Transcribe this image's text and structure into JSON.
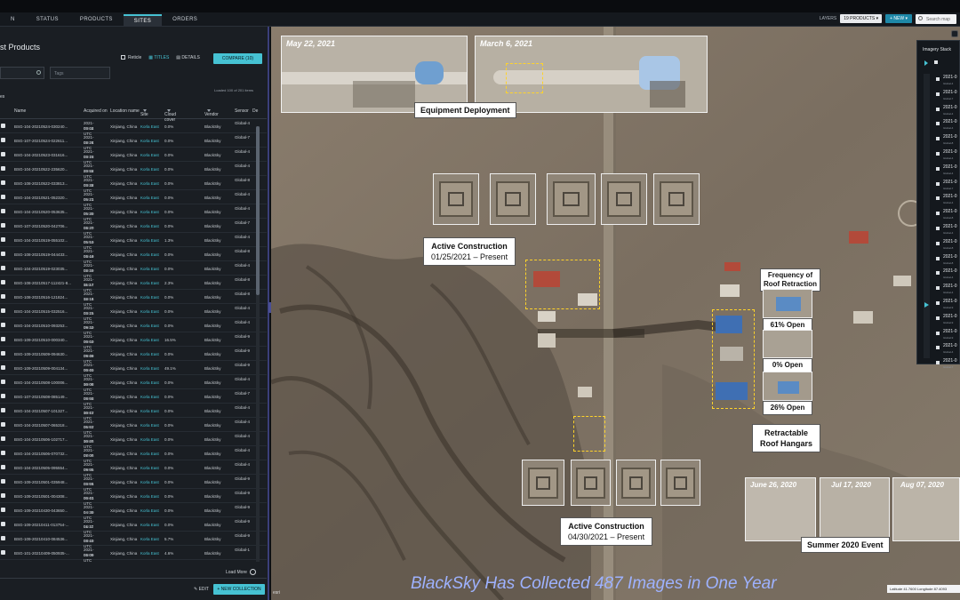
{
  "nav": {
    "tabs": [
      "N",
      "STATUS",
      "PRODUCTS",
      "SITES",
      "ORDERS"
    ],
    "active": "SITES"
  },
  "topbar": {
    "layers_label": "LAYERS",
    "layers_button": "19 PRODUCTS ▾",
    "new_button": "+ NEW ▾",
    "search_placeholder": "Search map"
  },
  "panel": {
    "title": "st Products",
    "reticle_label": "Reticle",
    "titles_label": "TITLES",
    "details_label": "DETAILS",
    "compare_button": "COMPARE (10)",
    "tags_placeholder": "Tags",
    "loaded_text": "Loaded 100 of 201 items",
    "header_left": "es",
    "columns": [
      "Name",
      "Acquired on",
      "Location name",
      "Site",
      "Cloud cover",
      "Vendor",
      "Sensor",
      "De"
    ],
    "rows": [
      {
        "name": "BSG-104-20210524-030240...",
        "date": "2021-05-24",
        "time": "03:02 UTC",
        "loc": "Xinjiang, China",
        "site": "Korla East",
        "cloud": "0.0%",
        "vendor": "BlackSky",
        "sensor": "Global-4"
      },
      {
        "name": "BSG-107-20210524-022611...",
        "date": "2021-05-24",
        "time": "02:26 UTC",
        "loc": "Xinjiang, China",
        "site": "Korla East",
        "cloud": "0.0%",
        "vendor": "BlackSky",
        "sensor": "Global-7"
      },
      {
        "name": "BSG-104-20210523-031616...",
        "date": "2021-05-23",
        "time": "03:16 UTC",
        "loc": "Xinjiang, China",
        "site": "Korla East",
        "cloud": "0.0%",
        "vendor": "BlackSky",
        "sensor": "Global-4"
      },
      {
        "name": "BSG-104-20210522-235620...",
        "date": "2021-05-22",
        "time": "23:56 UTC",
        "loc": "Xinjiang, China",
        "site": "Korla East",
        "cloud": "0.0%",
        "vendor": "BlackSky",
        "sensor": "Global-4"
      },
      {
        "name": "BSG-108-20210522-033813...",
        "date": "2021-05-22",
        "time": "03:38 UTC",
        "loc": "Xinjiang, China",
        "site": "Korla East",
        "cloud": "0.0%",
        "vendor": "BlackSky",
        "sensor": "Global-8"
      },
      {
        "name": "BSG-104-20210521-052320...",
        "date": "2021-05-21",
        "time": "05:23 UTC",
        "loc": "Xinjiang, China",
        "site": "Korla East",
        "cloud": "0.0%",
        "vendor": "BlackSky",
        "sensor": "Global-4"
      },
      {
        "name": "BSG-104-20210520-053635...",
        "date": "2021-05-20",
        "time": "05:36 UTC",
        "loc": "Xinjiang, China",
        "site": "Korla East",
        "cloud": "0.0%",
        "vendor": "BlackSky",
        "sensor": "Global-4"
      },
      {
        "name": "BSG-107-20210520-042706...",
        "date": "2021-05-20",
        "time": "04:27 UTC",
        "loc": "Xinjiang, China",
        "site": "Korla East",
        "cloud": "0.0%",
        "vendor": "BlackSky",
        "sensor": "Global-7"
      },
      {
        "name": "BSG-104-20210519-055102...",
        "date": "2021-05-19",
        "time": "05:51 UTC",
        "loc": "Xinjiang, China",
        "site": "Korla East",
        "cloud": "1.3%",
        "vendor": "BlackSky",
        "sensor": "Global-4"
      },
      {
        "name": "BSG-108-20210519-044433...",
        "date": "2021-05-19",
        "time": "04:44 UTC",
        "loc": "Xinjiang, China",
        "site": "Korla East",
        "cloud": "0.0%",
        "vendor": "BlackSky",
        "sensor": "Global-8"
      },
      {
        "name": "BSG-104-20210519-023035...",
        "date": "2021-05-19",
        "time": "02:30 UTC",
        "loc": "Xinjiang, China",
        "site": "Korla East",
        "cloud": "0.0%",
        "vendor": "BlackSky",
        "sensor": "Global-4"
      },
      {
        "name": "BSG-108-20210517-112421-8...",
        "date": "2021-05-17",
        "time": "11:24 UTC",
        "loc": "Xinjiang, China",
        "site": "Korla East",
        "cloud": "2.3%",
        "vendor": "BlackSky",
        "sensor": "Global-8"
      },
      {
        "name": "BSG-108-20210516-121824...",
        "date": "2021-05-16",
        "time": "12:18 UTC",
        "loc": "Xinjiang, China",
        "site": "Korla East",
        "cloud": "0.0%",
        "vendor": "BlackSky",
        "sensor": "Global-8"
      },
      {
        "name": "BSG-104-20210515-032516...",
        "date": "2021-05-15",
        "time": "03:25 UTC",
        "loc": "Xinjiang, China",
        "site": "Korla East",
        "cloud": "0.0%",
        "vendor": "BlackSky",
        "sensor": "Global-4"
      },
      {
        "name": "BSG-104-20210510-093253...",
        "date": "2021-05-10",
        "time": "09:32 UTC",
        "loc": "Xinjiang, China",
        "site": "Korla East",
        "cloud": "0.0%",
        "vendor": "BlackSky",
        "sensor": "Global-4"
      },
      {
        "name": "BSG-109-20210510-000340...",
        "date": "2021-05-10",
        "time": "00:03 UTC",
        "loc": "Xinjiang, China",
        "site": "Korla East",
        "cloud": "16.5%",
        "vendor": "BlackSky",
        "sensor": "Global-9"
      },
      {
        "name": "BSG-109-20210509-094630...",
        "date": "2021-05-09",
        "time": "09:46 UTC",
        "loc": "Xinjiang, China",
        "site": "Korla East",
        "cloud": "0.0%",
        "vendor": "BlackSky",
        "sensor": "Global-9"
      },
      {
        "name": "BSG-109-20210509-004134...",
        "date": "2021-05-09",
        "time": "00:41 UTC",
        "loc": "Xinjiang, China",
        "site": "Korla East",
        "cloud": "49.1%",
        "vendor": "BlackSky",
        "sensor": "Global-9"
      },
      {
        "name": "BSG-104-20210508-100006...",
        "date": "2021-05-08",
        "time": "10:00 UTC",
        "loc": "Xinjiang, China",
        "site": "Korla East",
        "cloud": "0.0%",
        "vendor": "BlackSky",
        "sensor": "Global-4"
      },
      {
        "name": "BSG-107-20210508-085149...",
        "date": "2021-05-08",
        "time": "08:51 UTC",
        "loc": "Xinjiang, China",
        "site": "Korla East",
        "cloud": "0.0%",
        "vendor": "BlackSky",
        "sensor": "Global-7"
      },
      {
        "name": "BSG-104-20210507-101327...",
        "date": "2021-05-07",
        "time": "10:13 UTC",
        "loc": "Xinjiang, China",
        "site": "Korla East",
        "cloud": "0.0%",
        "vendor": "BlackSky",
        "sensor": "Global-4"
      },
      {
        "name": "BSG-104-20210507-065318...",
        "date": "2021-05-07",
        "time": "06:53 UTC",
        "loc": "Xinjiang, China",
        "site": "Korla East",
        "cloud": "0.0%",
        "vendor": "BlackSky",
        "sensor": "Global-4"
      },
      {
        "name": "BSG-104-20210506-102717...",
        "date": "2021-05-06",
        "time": "10:27 UTC",
        "loc": "Xinjiang, China",
        "site": "Korla East",
        "cloud": "0.0%",
        "vendor": "BlackSky",
        "sensor": "Global-4"
      },
      {
        "name": "BSG-104-20210506-070732...",
        "date": "2021-05-06",
        "time": "07:07 UTC",
        "loc": "Xinjiang, China",
        "site": "Korla East",
        "cloud": "0.0%",
        "vendor": "BlackSky",
        "sensor": "Global-4"
      },
      {
        "name": "BSG-104-20210505-095554...",
        "date": "2021-05-05",
        "time": "09:55 UTC",
        "loc": "Xinjiang, China",
        "site": "Korla East",
        "cloud": "0.0%",
        "vendor": "BlackSky",
        "sensor": "Global-4"
      },
      {
        "name": "BSG-109-20210501-035948...",
        "date": "2021-05-01",
        "time": "03:59 UTC",
        "loc": "Xinjiang, China",
        "site": "Korla East",
        "cloud": "0.0%",
        "vendor": "BlackSky",
        "sensor": "Global-9"
      },
      {
        "name": "BSG-109-20210501-004308...",
        "date": "2021-05-01",
        "time": "00:43 UTC",
        "loc": "Xinjiang, China",
        "site": "Korla East",
        "cloud": "0.0%",
        "vendor": "BlackSky",
        "sensor": "Global-9"
      },
      {
        "name": "BSG-109-20210430-043650...",
        "date": "2021-04-30",
        "time": "04:36 UTC",
        "loc": "Xinjiang, China",
        "site": "Korla East",
        "cloud": "0.0%",
        "vendor": "BlackSky",
        "sensor": "Global-9"
      },
      {
        "name": "BSG-109-20210411-013754-...",
        "date": "2021-04-11",
        "time": "01:37 UTC",
        "loc": "Xinjiang, China",
        "site": "Korla East",
        "cloud": "0.0%",
        "vendor": "BlackSky",
        "sensor": "Global-9"
      },
      {
        "name": "BSG-109-20210410-084536...",
        "date": "2021-04-10",
        "time": "08:45 UTC",
        "loc": "Xinjiang, China",
        "site": "Korla East",
        "cloud": "5.7%",
        "vendor": "BlackSky",
        "sensor": "Global-9"
      },
      {
        "name": "BSG-101-20210409-050935-...",
        "date": "2021-04-09",
        "time": "05:09 UTC",
        "loc": "Xinjiang, China",
        "site": "Korla East",
        "cloud": "4.6%",
        "vendor": "BlackSky",
        "sensor": "Global-1"
      }
    ],
    "load_more": "Load More",
    "edit_button": "✎ EDIT",
    "new_collection_button": "+ NEW COLLECTION"
  },
  "map": {
    "inset1_date": "May 22, 2021",
    "inset2_date": "March 6, 2021",
    "equipment_label": "Equipment Deployment",
    "active1_title": "Active Construction",
    "active1_dates": "01/25/2021 – Present",
    "active2_title": "Active Construction",
    "active2_dates": "04/30/2021 – Present",
    "freq_title_1": "Frequency of",
    "freq_title_2": "Roof Retraction",
    "pct_61": "61% Open",
    "pct_0": "0% Open",
    "pct_26": "26% Open",
    "hangars_1": "Retractable",
    "hangars_2": "Roof Hangars",
    "summer_dates": [
      "June 26, 2020",
      "Jul 17, 2020",
      "Aug 07, 2020"
    ],
    "summer_label": "Summer 2020 Event",
    "caption": "BlackSky Has Collected 487 Images in One Year",
    "coord_text": "Latitude 41.7600  Longitude 87.4093",
    "watermark": "esri"
  },
  "stack": {
    "title": "Imagery Stack",
    "items": [
      {
        "d": "2021-0",
        "s": "Global-4"
      },
      {
        "d": "2021-0",
        "s": "Global-7"
      },
      {
        "d": "2021-0",
        "s": "Global-4"
      },
      {
        "d": "2021-0",
        "s": "Global-4"
      },
      {
        "d": "2021-0",
        "s": "Global-8"
      },
      {
        "d": "2021-0",
        "s": "Global-4"
      },
      {
        "d": "2021-0",
        "s": "Global-4"
      },
      {
        "d": "2021-0",
        "s": "Global-7"
      },
      {
        "d": "2021-0",
        "s": "Global-4"
      },
      {
        "d": "2021-0",
        "s": "Global-8"
      },
      {
        "d": "2021-0",
        "s": "Global-4"
      },
      {
        "d": "2021-0",
        "s": "Global-8"
      },
      {
        "d": "2021-0",
        "s": "Global-8"
      },
      {
        "d": "2021-0",
        "s": "Global-4"
      },
      {
        "d": "2021-0",
        "s": "Global-4"
      },
      {
        "d": "2021-0",
        "s": "Global-9"
      },
      {
        "d": "2021-0",
        "s": "Global-9"
      },
      {
        "d": "2021-0",
        "s": "Global-9"
      },
      {
        "d": "2021-0",
        "s": "Global-4"
      },
      {
        "d": "2021-0",
        "s": "Global-7"
      }
    ]
  },
  "colors": {
    "accent": "#46c2d3",
    "panel": "#1a1e23",
    "caption": "#9eb2ff",
    "dashed": "#ffd32a"
  }
}
